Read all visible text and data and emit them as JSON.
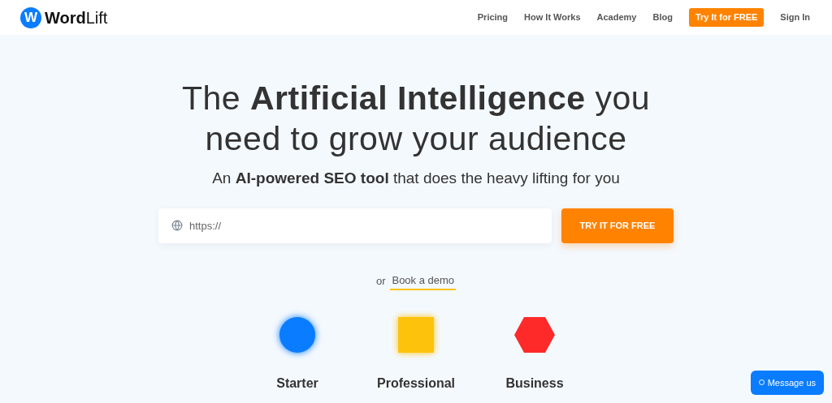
{
  "header": {
    "logo_mark": "W",
    "logo_text": "**Word**Lift",
    "nav": [
      {
        "label": "Pricing",
        "kind": "link"
      },
      {
        "label": "How It Works",
        "kind": "link"
      },
      {
        "label": "Academy",
        "kind": "link"
      },
      {
        "label": "Blog",
        "kind": "link"
      },
      {
        "label": "Try It for FREE",
        "kind": "cta"
      },
      {
        "label": "Sign In",
        "kind": "link"
      }
    ]
  },
  "hero": {
    "headline": "The **Artificial Intelligence** you need to grow your audience",
    "subtitle": "An **AI-powered SEO tool** that does the heavy lifting for you",
    "url_field": {
      "placeholder": "https://"
    },
    "cta": "TRY IT FOR FREE",
    "or": "or",
    "demo_link": "Book a demo"
  },
  "plans": [
    {
      "name": "Starter",
      "kind": "circle",
      "color": "#0a7cff"
    },
    {
      "name": "Professional",
      "kind": "square",
      "color": "#fdc30c"
    },
    {
      "name": "Business",
      "kind": "hexagon",
      "color": "#fe2a2a"
    }
  ],
  "chat": {
    "label": "Message us"
  }
}
